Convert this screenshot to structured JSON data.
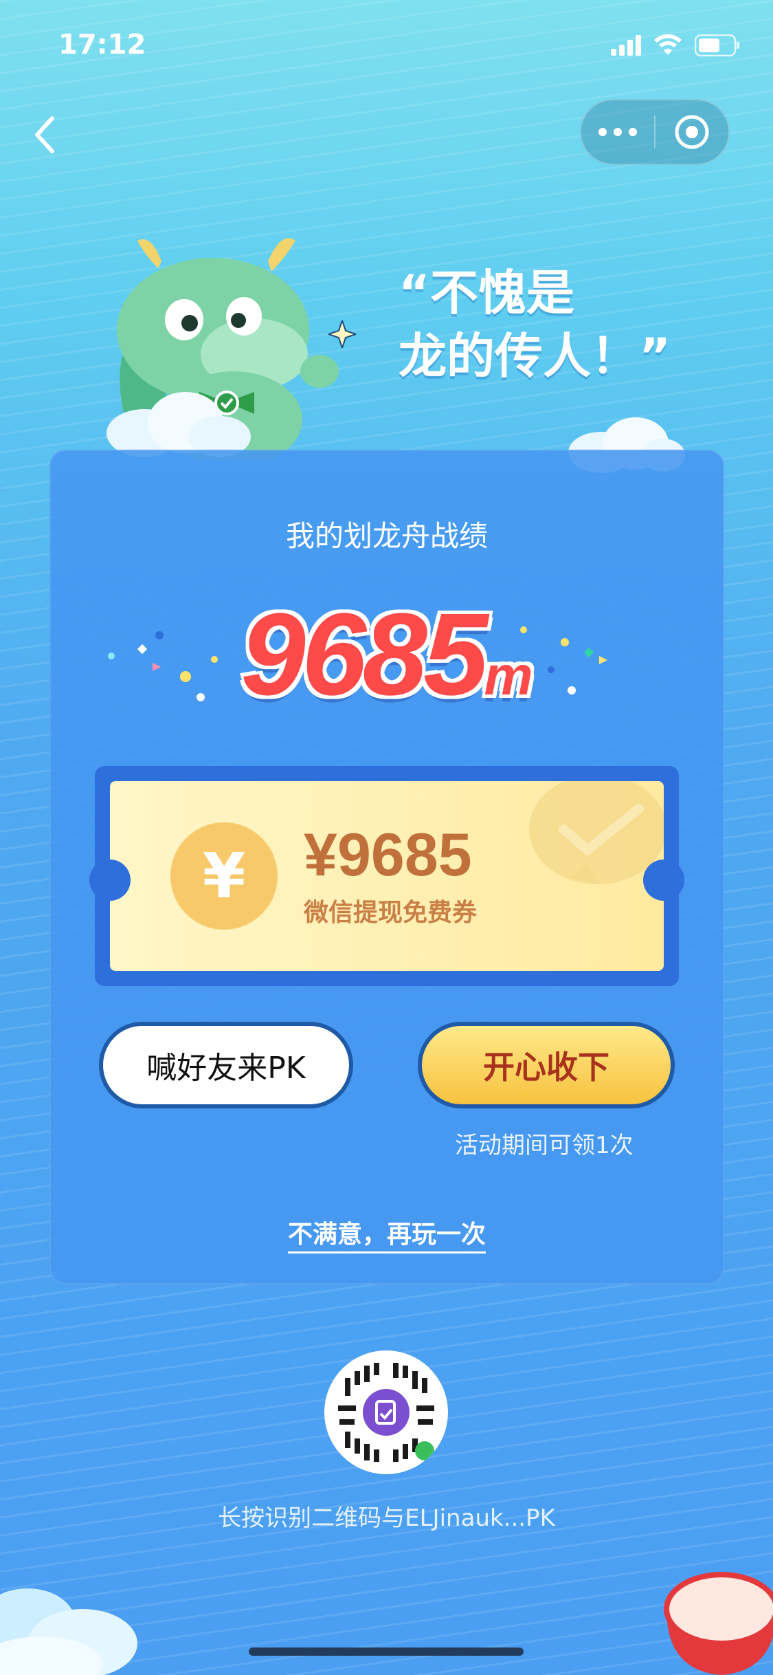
{
  "status_bar": {
    "time": "17:12"
  },
  "nav": {
    "back_icon": "chevron-left-icon",
    "more_icon": "more-dots-icon",
    "close_icon": "target-close-icon"
  },
  "headline": {
    "line1": "“不愧是",
    "line2": "龙的传人！”"
  },
  "card": {
    "title": "我的划龙舟战绩",
    "score_value": "9685",
    "score_unit": "m"
  },
  "voucher": {
    "coin_symbol": "¥",
    "amount": "¥9685",
    "label": "微信提现免费券"
  },
  "buttons": {
    "pk_label": "喊好友来PK",
    "accept_label": "开心收下",
    "accept_note": "活动期间可领1次",
    "replay_label": "不满意，再玩一次"
  },
  "qr": {
    "caption": "长按识别二维码与ELJinauk...PK"
  },
  "colors": {
    "accent_red": "#ff4a4a",
    "button_border": "#1e5aa8",
    "voucher_text": "#c0703a"
  }
}
